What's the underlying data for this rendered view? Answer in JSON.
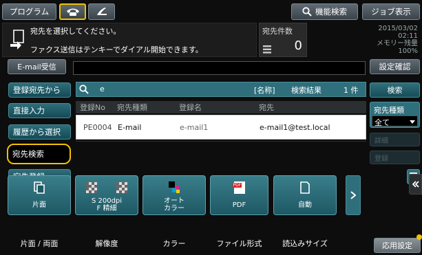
{
  "top_bar": {
    "program_label": "プログラム",
    "function_search_label": "機能検索",
    "job_display_label": "ジョブ表示"
  },
  "message": {
    "line1": "宛先を選択してください。",
    "line2": "ファクス送信はテンキーでダイアル開始できます。"
  },
  "dest_count": {
    "label": "宛先件数",
    "value": "0"
  },
  "status": {
    "date": "2015/03/02",
    "time": "02:11",
    "memory_label": "メモリー残量",
    "memory_value": "100%"
  },
  "email_receive_label": "E-mail受信",
  "settings_confirm_label": "設定確認",
  "left_nav": [
    {
      "label": "登録宛先から"
    },
    {
      "label": "直接入力"
    },
    {
      "label": "履歴から選択"
    },
    {
      "label": "宛先検索"
    },
    {
      "label": "宛先登録"
    }
  ],
  "search": {
    "query": "e",
    "field": "[名称]",
    "result_label": "検索結果",
    "result_count": "1 件"
  },
  "table": {
    "headers": [
      "登録No",
      "宛先種類",
      "登録名",
      "宛先"
    ],
    "rows": [
      [
        "PE0004",
        "E-mail",
        "e-mail1",
        "e-mail1@test.local"
      ]
    ]
  },
  "right_panel": {
    "search_label": "検索",
    "dest_type_label": "宛先種類",
    "dest_type_value": "全て",
    "detail_label": "詳細",
    "register_label": "登録"
  },
  "tiles": [
    {
      "icon": "single-sided-icon",
      "label": "片面",
      "caption": "片面 / 両面"
    },
    {
      "icon": "resolution-icon",
      "label": "S 200dpi\nF 精細",
      "caption": "解像度"
    },
    {
      "icon": "color-icon",
      "label": "オート\nカラー",
      "caption": "カラー"
    },
    {
      "icon": "pdf-file-icon",
      "label": "PDF",
      "caption": "ファイル形式",
      "icon_text": "PDF"
    },
    {
      "icon": "page-icon",
      "label": "自動",
      "caption": "読込みサイズ"
    }
  ],
  "application_settings_label": "応用設定",
  "colors": {
    "teal": "#1e5865",
    "highlight": "#f2c200"
  }
}
